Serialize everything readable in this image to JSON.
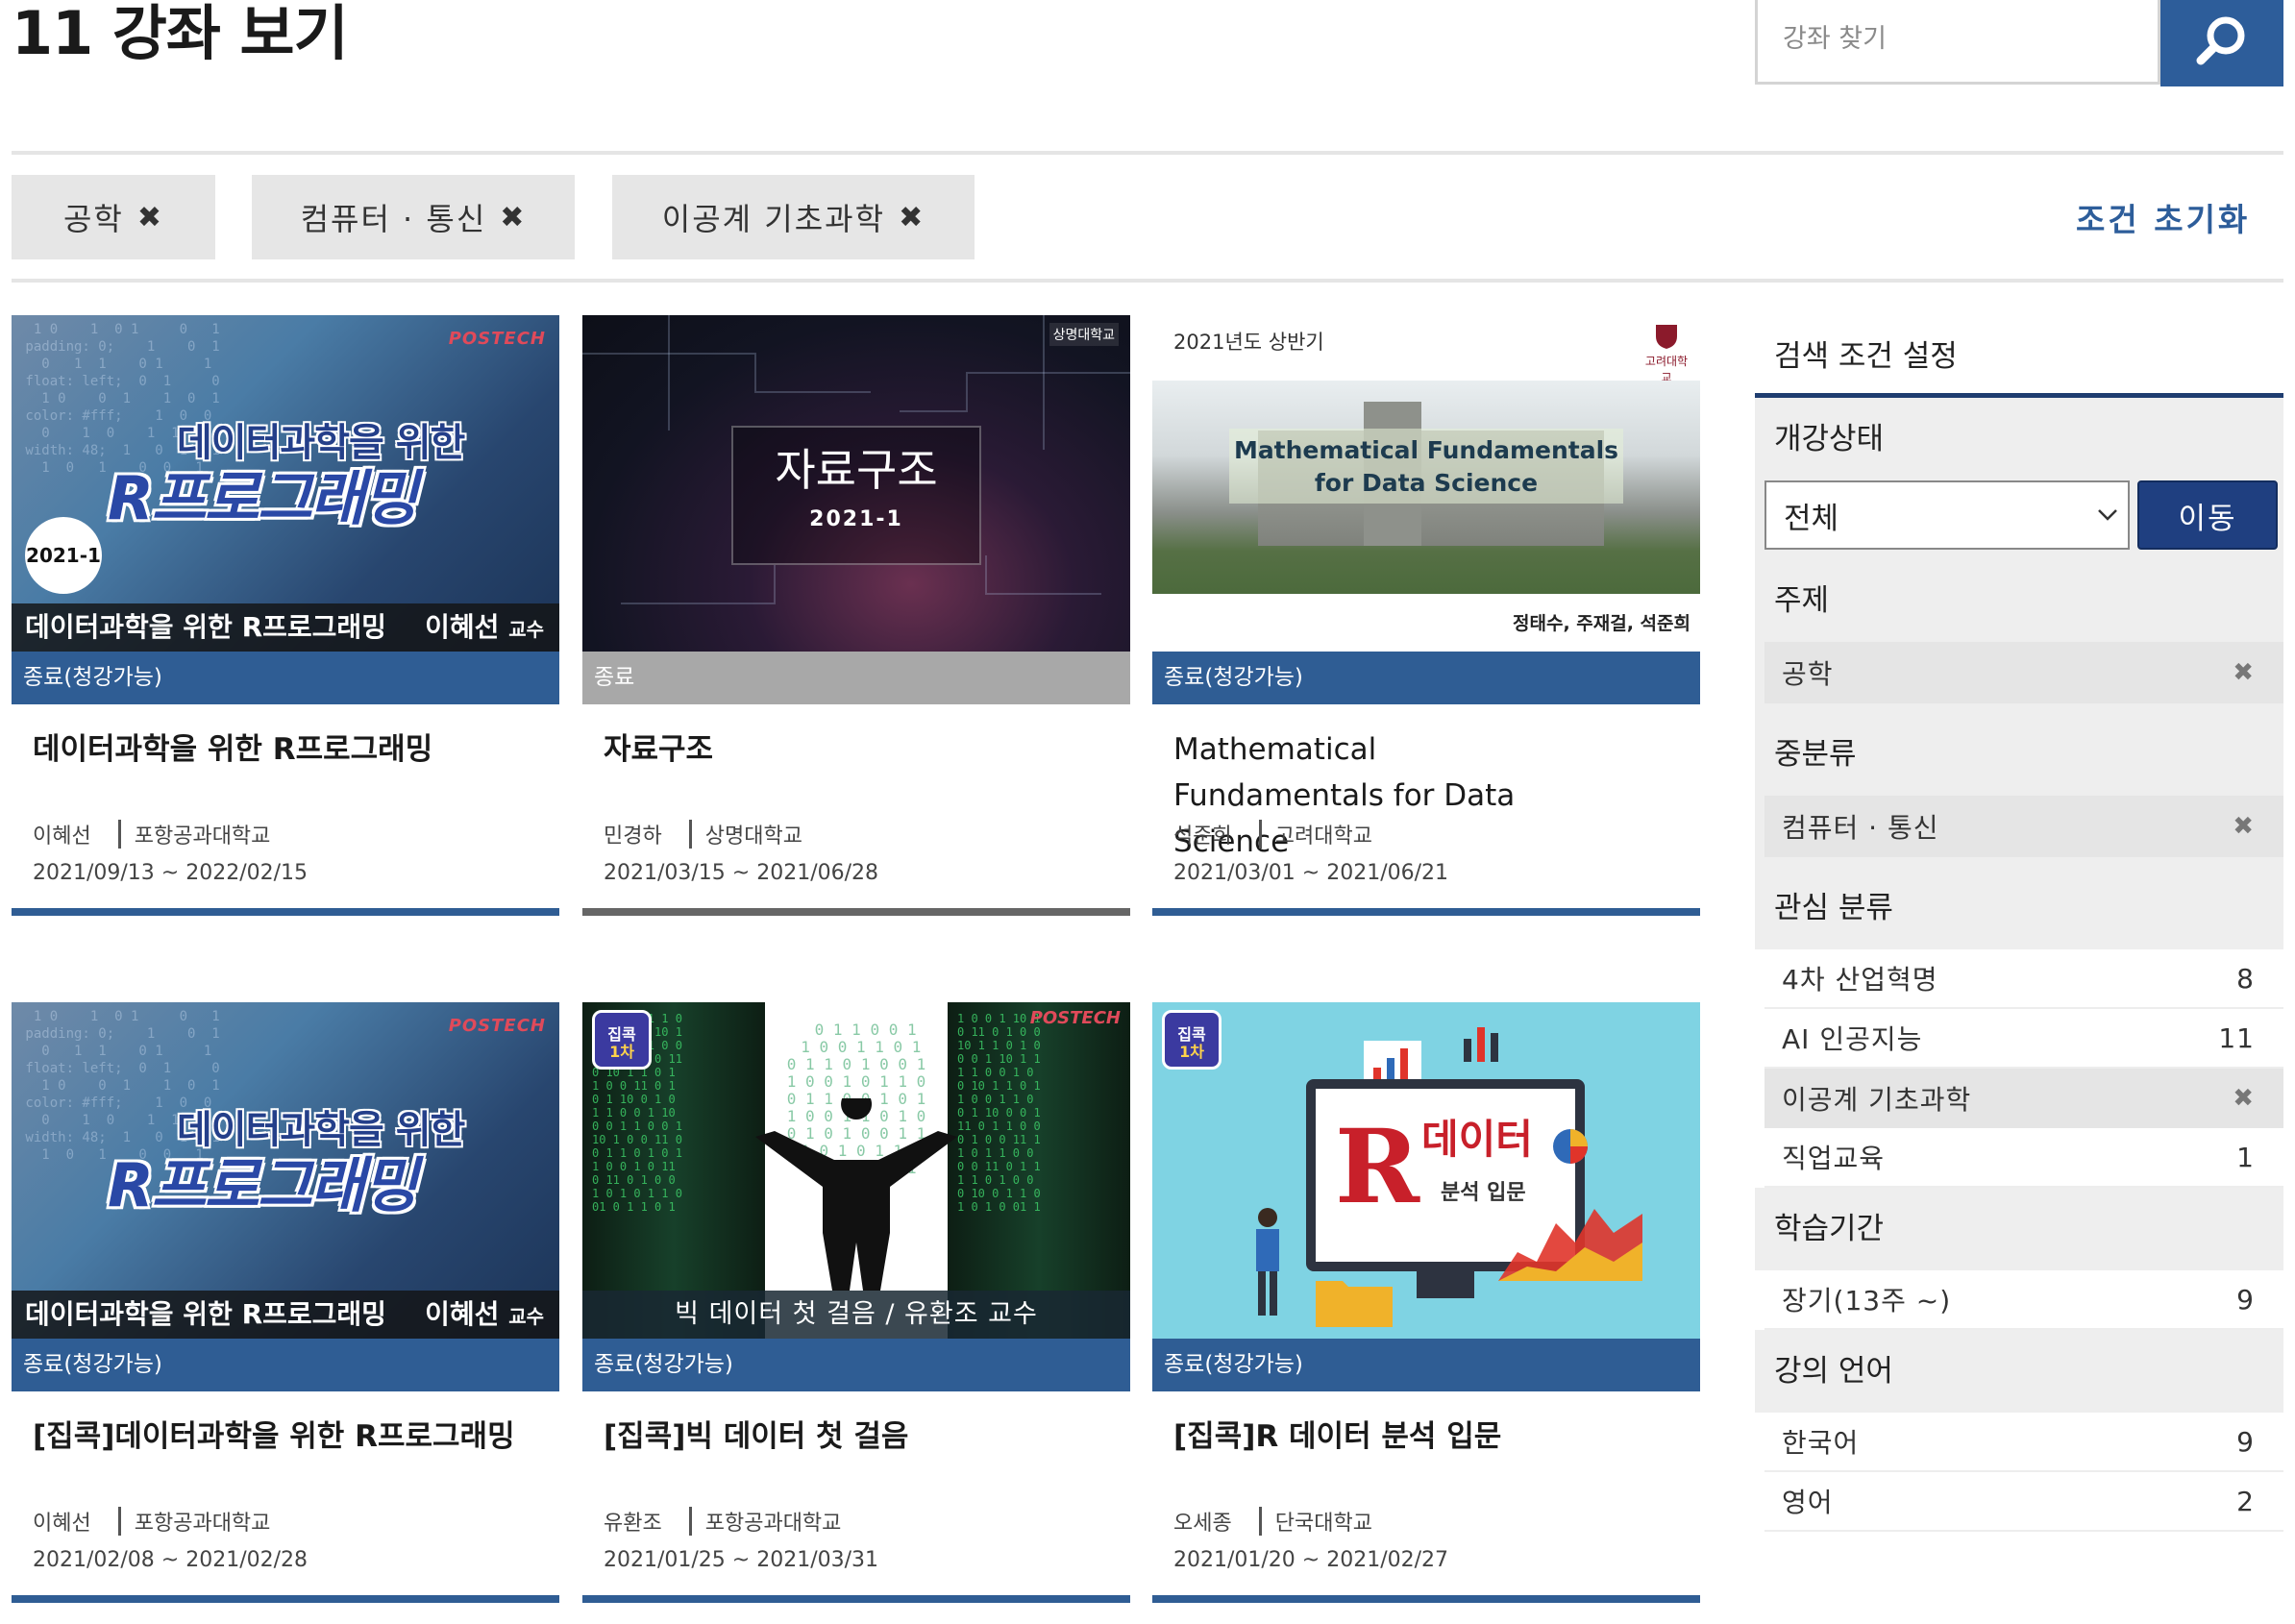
{
  "header": {
    "title": "11 강좌 보기",
    "search_placeholder": "강좌 찾기"
  },
  "filters": {
    "chips": [
      "공학",
      "컴퓨터 · 통신",
      "이공계 기초과학"
    ],
    "reset_label": "조건 초기화"
  },
  "courses": [
    {
      "title": "데이터과학을 위한 R프로그래밍",
      "status": "종료(청강가능)",
      "instructor": "이혜선",
      "university": "포항공과대학교",
      "dates": "2021/09/13 ~ 2022/02/15",
      "thumb": {
        "brand": "POSTECH",
        "line1": "데이터과학을 위한",
        "line2": "R프로그래밍",
        "badge": "2021-1",
        "caption": "데이터과학을 위한 R프로그래밍",
        "prof": "이혜선",
        "prof_suffix": "교수"
      }
    },
    {
      "title": "자료구조",
      "status": "종료",
      "instructor": "민경하",
      "university": "상명대학교",
      "dates": "2021/03/15 ~ 2021/06/28",
      "thumb": {
        "logo": "상명대학교",
        "line1": "자료구조",
        "line2": "2021-1"
      }
    },
    {
      "title": "Mathematical Fundamentals for Data Science",
      "status": "종료(청강가능)",
      "instructor": "석준희",
      "university": "고려대학교",
      "dates": "2021/03/01 ~ 2021/06/21",
      "thumb": {
        "top": "2021년도 상반기",
        "logo": "고려대학교",
        "line1": "Mathematical Fundamentals",
        "line2": "for Data Science",
        "names": "정태수, 주재걸, 석준희"
      }
    },
    {
      "title": "[집콕]데이터과학을 위한 R프로그래밍",
      "status": "종료(청강가능)",
      "instructor": "이혜선",
      "university": "포항공과대학교",
      "dates": "2021/02/08 ~ 2021/02/28",
      "thumb": {
        "brand": "POSTECH",
        "line1": "데이터과학을 위한",
        "line2": "R프로그래밍",
        "caption": "데이터과학을 위한 R프로그래밍",
        "prof": "이혜선",
        "prof_suffix": "교수"
      }
    },
    {
      "title": "[집콕]빅 데이터 첫 걸음",
      "status": "종료(청강가능)",
      "instructor": "유환조",
      "university": "포항공과대학교",
      "dates": "2021/01/25 ~ 2021/03/31",
      "thumb": {
        "brand": "POSTECH",
        "tag1": "집콕",
        "tag2": "1차",
        "caption": "빅 데이터 첫 걸음 / 유환조 교수"
      }
    },
    {
      "title": "[집콕]R 데이터 분석 입문",
      "status": "종료(청강가능)",
      "instructor": "오세종",
      "university": "단국대학교",
      "dates": "2021/01/20 ~ 2021/02/27",
      "thumb": {
        "tag1": "집콕",
        "tag2": "1차",
        "big": "R",
        "line1": "데이터",
        "line2": "분석 입문"
      }
    }
  ],
  "sidebar": {
    "title": "검색 조건 설정",
    "status": {
      "heading": "개강상태",
      "selected": "전체",
      "go_label": "이동"
    },
    "subject": {
      "heading": "주제",
      "items": [
        {
          "label": "공학"
        }
      ]
    },
    "middle": {
      "heading": "중분류",
      "items": [
        {
          "label": "컴퓨터 · 통신"
        }
      ]
    },
    "interest": {
      "heading": "관심 분류",
      "items": [
        {
          "label": "4차 산업혁명",
          "count": "8"
        },
        {
          "label": "AI 인공지능",
          "count": "11"
        },
        {
          "label": "이공계 기초과학",
          "count": ""
        },
        {
          "label": "직업교육",
          "count": "1"
        }
      ]
    },
    "period": {
      "heading": "학습기간",
      "items": [
        {
          "label": "장기(13주 ~)",
          "count": "9"
        }
      ]
    },
    "language": {
      "heading": "강의 언어",
      "items": [
        {
          "label": "한국어",
          "count": "9"
        },
        {
          "label": "영어",
          "count": "2"
        }
      ]
    }
  },
  "colors": {
    "accent": "#2d5d9a",
    "status_bar": "#2f5d94",
    "ended": "#a8a8a8",
    "sidebar_line": "#1f3d70"
  }
}
